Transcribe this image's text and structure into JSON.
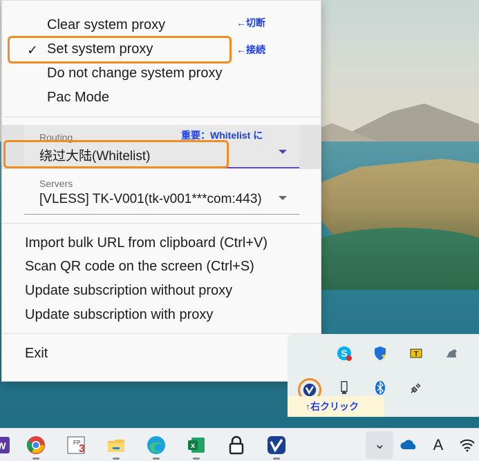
{
  "menu": {
    "proxy_items": [
      {
        "label": "Clear system proxy",
        "checked": false
      },
      {
        "label": "Set system proxy",
        "checked": true
      },
      {
        "label": "Do not change system proxy",
        "checked": false
      },
      {
        "label": "Pac Mode",
        "checked": false
      }
    ],
    "check_mark": "✓",
    "routing": {
      "label": "Routing",
      "value": "绕过大陆(Whitelist)"
    },
    "servers": {
      "label": "Servers",
      "value": "[VLESS] TK-V001(tk-v001***com:443)"
    },
    "action_items": [
      "Import bulk URL from clipboard (Ctrl+V)",
      "Scan QR code on the screen (Ctrl+S)",
      "Update subscription without proxy",
      "Update subscription with proxy"
    ],
    "exit_label": "Exit"
  },
  "annotations": {
    "clear": "←切断",
    "set": "←接続",
    "routing": "重要：Whitelist に",
    "tray": "↑右クリック"
  },
  "tray": {
    "icons": [
      "skype-icon",
      "defender-icon",
      "usb-yellow-icon",
      "horse-icon",
      "v2rayn-icon",
      "usb-icon",
      "bluetooth-icon",
      "plug-icon"
    ]
  },
  "taskbar": {
    "apps": [
      "word-icon",
      "chrome-icon",
      "fp3-icon",
      "file-explorer-icon",
      "edge-icon",
      "excel-icon",
      "lock-icon",
      "v2rayn-icon"
    ],
    "chevron_label": "⌄",
    "ime_label": "A",
    "fp_label": "FP",
    "fp_number": "3",
    "excel_letter": "x",
    "word_letter": "W"
  },
  "colors": {
    "annotation_text": "#1a3fe8",
    "annotation_box": "#f08c24",
    "accent_underline": "#6a4bc4"
  }
}
